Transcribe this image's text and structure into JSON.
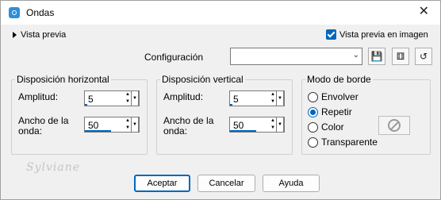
{
  "window": {
    "title": "Ondas"
  },
  "preview": {
    "toggle_label": "Vista previa",
    "checkbox_label": "Vista previa en imagen",
    "checked": true
  },
  "config": {
    "label": "Configuración",
    "value": ""
  },
  "horizontal": {
    "title": "Disposición horizontal",
    "amplitude_label": "Amplitud:",
    "amplitude_value": "5",
    "wavelength_label_1": "Ancho de la",
    "wavelength_label_2": "onda:",
    "wavelength_value": "50"
  },
  "vertical": {
    "title": "Disposición vertical",
    "amplitude_label": "Amplitud:",
    "amplitude_value": "5",
    "wavelength_label_1": "Ancho de la",
    "wavelength_label_2": "onda:",
    "wavelength_value": "50"
  },
  "edge_mode": {
    "title": "Modo de borde",
    "options": [
      "Envolver",
      "Repetir",
      "Color",
      "Transparente"
    ],
    "selected": "Repetir"
  },
  "buttons": {
    "accept": "Aceptar",
    "cancel": "Cancelar",
    "help": "Ayuda"
  },
  "watermark": "Sylviane",
  "colors": {
    "accent": "#0067c0"
  }
}
